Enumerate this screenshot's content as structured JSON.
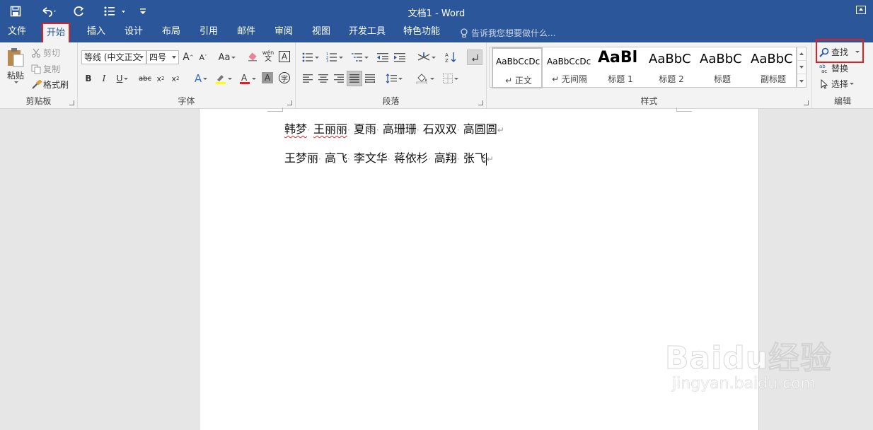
{
  "titlebar": {
    "title": "文档1 - Word",
    "qa_icons": [
      "save-icon",
      "undo-icon",
      "redo-icon",
      "bullets-icon",
      "customize-icon"
    ]
  },
  "tabs": [
    {
      "label": "文件"
    },
    {
      "label": "开始"
    },
    {
      "label": "插入"
    },
    {
      "label": "设计"
    },
    {
      "label": "布局"
    },
    {
      "label": "引用"
    },
    {
      "label": "邮件"
    },
    {
      "label": "审阅"
    },
    {
      "label": "视图"
    },
    {
      "label": "开发工具"
    },
    {
      "label": "特色功能"
    }
  ],
  "active_tab": "开始",
  "tell_me": "告诉我您想要做什么...",
  "clipboard": {
    "paste": "粘贴",
    "cut": "剪切",
    "copy": "复制",
    "format_painter": "格式刷",
    "label": "剪贴板"
  },
  "font": {
    "font_name": "等线 (中文正文",
    "font_size": "四号",
    "change_case": "Aa",
    "phonetic": "wén",
    "phonetic_char": "文",
    "border_char": "A",
    "char_shading": "A",
    "enclose_char": "字",
    "label": "字体"
  },
  "paragraph": {
    "label": "段落"
  },
  "styles": {
    "items": [
      {
        "preview": "AaBbCcDc",
        "name": "↵ 正文"
      },
      {
        "preview": "AaBbCcDc",
        "name": "↵ 无间隔"
      },
      {
        "preview": "AaBl",
        "name": "标题 1"
      },
      {
        "preview": "AaBbC",
        "name": "标题 2"
      },
      {
        "preview": "AaBbC",
        "name": "标题"
      },
      {
        "preview": "AaBbC",
        "name": "副标题"
      }
    ],
    "label": "样式"
  },
  "editing": {
    "find": "查找",
    "replace": "替换",
    "select": "选择",
    "label": "编辑"
  },
  "document": {
    "line1": [
      "韩梦",
      "王丽丽",
      "夏雨",
      "高珊珊",
      "石双双",
      "高圆圆"
    ],
    "line2": [
      "王梦丽",
      "高飞",
      "李文华",
      "蒋依杉",
      "高翔",
      "张飞"
    ],
    "separator": "·"
  },
  "watermark": {
    "main": "Baidu经验",
    "sub": "jingyan.baidu.com"
  },
  "colors": {
    "title_bar": "#2b579a",
    "ribbon": "#f3f3f3",
    "highlight": "#e02020"
  }
}
